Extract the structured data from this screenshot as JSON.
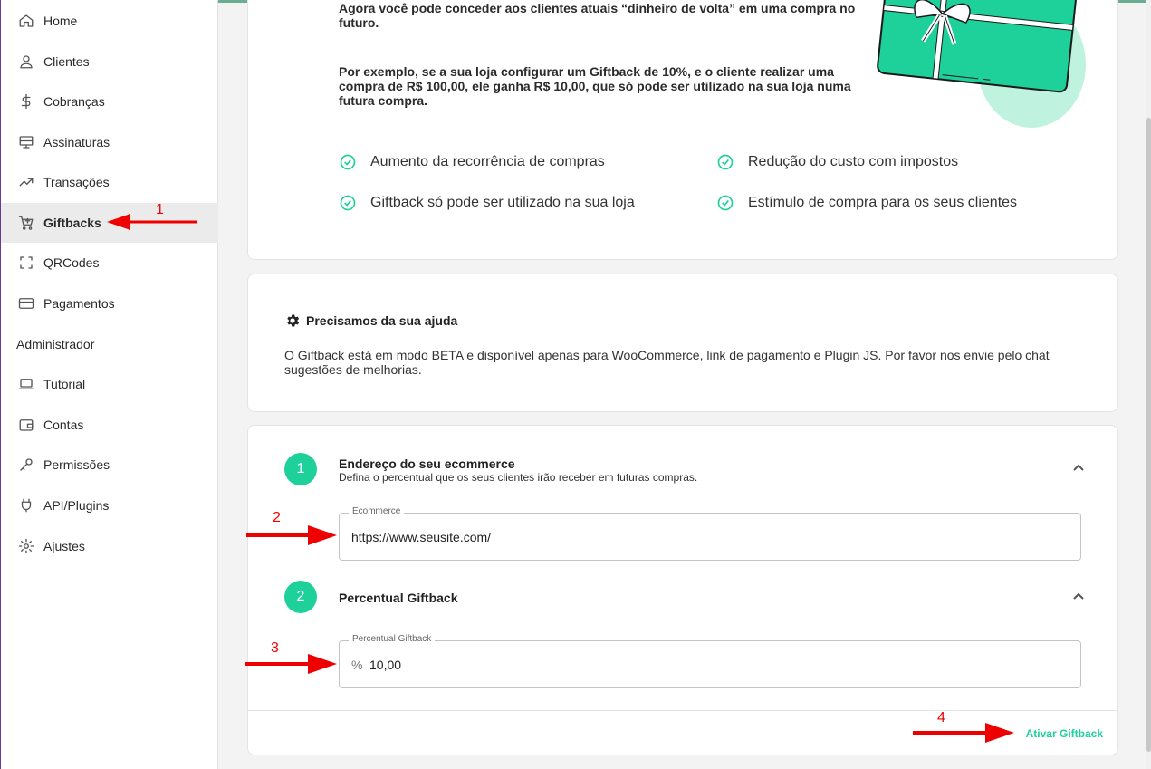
{
  "sidebar": {
    "items": [
      {
        "label": "Home",
        "icon": "home-icon"
      },
      {
        "label": "Clientes",
        "icon": "person-icon"
      },
      {
        "label": "Cobranças",
        "icon": "dollar-icon"
      },
      {
        "label": "Assinaturas",
        "icon": "monitor-icon"
      },
      {
        "label": "Transações",
        "icon": "trending-up-icon"
      },
      {
        "label": "Giftbacks",
        "icon": "cart-icon",
        "active": true
      },
      {
        "label": "QRCodes",
        "icon": "qr-frame-icon"
      },
      {
        "label": "Pagamentos",
        "icon": "credit-card-icon"
      }
    ],
    "section_label": "Administrador",
    "admin_items": [
      {
        "label": "Tutorial",
        "icon": "laptop-icon"
      },
      {
        "label": "Contas",
        "icon": "wallet-icon"
      },
      {
        "label": "Permissões",
        "icon": "key-icon"
      },
      {
        "label": "API/Plugins",
        "icon": "plug-icon"
      },
      {
        "label": "Ajustes",
        "icon": "gear-icon"
      }
    ]
  },
  "intro": {
    "line1": "Agora você pode conceder aos clientes atuais “dinheiro de volta” em uma compra no futuro.",
    "line2": "Por exemplo, se a sua loja configurar um Giftback de 10%, e o cliente realizar uma compra de R$ 100,00, ele ganha R$ 10,00, que só pode ser utilizado na sua loja numa futura compra."
  },
  "benefits": [
    "Aumento da recorrência de compras",
    "Redução do custo com impostos",
    "Giftback só pode ser utilizado na sua loja",
    "Estímulo de compra para os seus clientes"
  ],
  "help": {
    "title": "Precisamos da sua ajuda",
    "text": "O Giftback está em modo BETA e disponível apenas para WooCommerce, link de pagamento e Plugin JS. Por favor nos envie pelo chat sugestões de melhorias."
  },
  "steps": [
    {
      "number": "1",
      "title": "Endereço do seu ecommerce",
      "subtitle": "Defina o percentual que os seus clientes irão receber em futuras compras.",
      "field_label": "Ecommerce",
      "field_value": "https://www.seusite.com/"
    },
    {
      "number": "2",
      "title": "Percentual Giftback",
      "field_label": "Percentual Giftback",
      "field_prefix": "%",
      "field_value": "10,00"
    }
  ],
  "activate_label": "Ativar Giftback",
  "annotations": [
    "1",
    "2",
    "3",
    "4"
  ],
  "colors": {
    "accent": "#1ed09a",
    "annotation": "#ee0000"
  }
}
